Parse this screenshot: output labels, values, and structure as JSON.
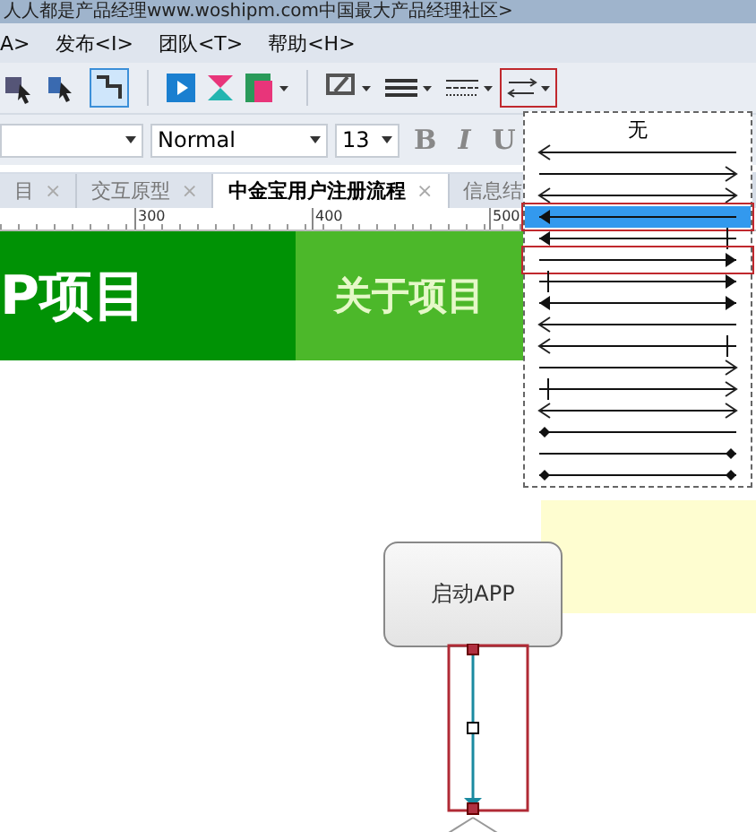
{
  "window": {
    "title": "人人都是产品经理www.woshipm.com中国最大产品经理社区>"
  },
  "menu": [
    "A>",
    "发布<I>",
    "团队<T>",
    "帮助<H>"
  ],
  "format_bar": {
    "font_style": "Normal",
    "font_size": "13",
    "bold": "B",
    "italic": "I",
    "underline": "U"
  },
  "tabs": [
    {
      "label": "目",
      "selected": false,
      "close": "×"
    },
    {
      "label": "交互原型",
      "selected": false,
      "close": "×"
    },
    {
      "label": "中金宝用户注册流程",
      "selected": true,
      "close": "×"
    },
    {
      "label": "信息结",
      "selected": false
    }
  ],
  "ruler": [
    "300",
    "400",
    "500"
  ],
  "banner": {
    "title": "P项目",
    "link": "关于项目"
  },
  "arrow_menu": {
    "none_label": "无",
    "styles": [
      {
        "ends": [
          {
            "kind": "open"
          },
          {
            "kind": "none"
          }
        ],
        "selected": false
      },
      {
        "ends": [
          {
            "kind": "none"
          },
          {
            "kind": "open"
          }
        ],
        "selected": false
      },
      {
        "ends": [
          {
            "kind": "open"
          },
          {
            "kind": "open"
          }
        ],
        "selected": false
      },
      {
        "ends": [
          {
            "kind": "filled"
          },
          {
            "kind": "none"
          }
        ],
        "selected": true,
        "marked": true
      },
      {
        "ends": [
          {
            "kind": "filled"
          },
          {
            "kind": "tick"
          }
        ],
        "selected": false
      },
      {
        "ends": [
          {
            "kind": "none"
          },
          {
            "kind": "filled"
          }
        ],
        "selected": false,
        "marked": true
      },
      {
        "ends": [
          {
            "kind": "tick"
          },
          {
            "kind": "filled"
          }
        ],
        "selected": false
      },
      {
        "ends": [
          {
            "kind": "filled"
          },
          {
            "kind": "filled"
          }
        ],
        "selected": false
      },
      {
        "ends": [
          {
            "kind": "open"
          },
          {
            "kind": "none"
          }
        ],
        "selected": false
      },
      {
        "ends": [
          {
            "kind": "open"
          },
          {
            "kind": "tick"
          }
        ],
        "selected": false
      },
      {
        "ends": [
          {
            "kind": "none"
          },
          {
            "kind": "open"
          }
        ],
        "selected": false
      },
      {
        "ends": [
          {
            "kind": "tick"
          },
          {
            "kind": "open"
          }
        ],
        "selected": false
      },
      {
        "ends": [
          {
            "kind": "open"
          },
          {
            "kind": "open"
          }
        ],
        "selected": false
      },
      {
        "ends": [
          {
            "kind": "diamond"
          },
          {
            "kind": "none"
          }
        ],
        "selected": false
      },
      {
        "ends": [
          {
            "kind": "none"
          },
          {
            "kind": "diamond"
          }
        ],
        "selected": false
      },
      {
        "ends": [
          {
            "kind": "diamond"
          },
          {
            "kind": "diamond"
          }
        ],
        "selected": false
      }
    ]
  },
  "flow_node": {
    "label": "启动APP"
  }
}
